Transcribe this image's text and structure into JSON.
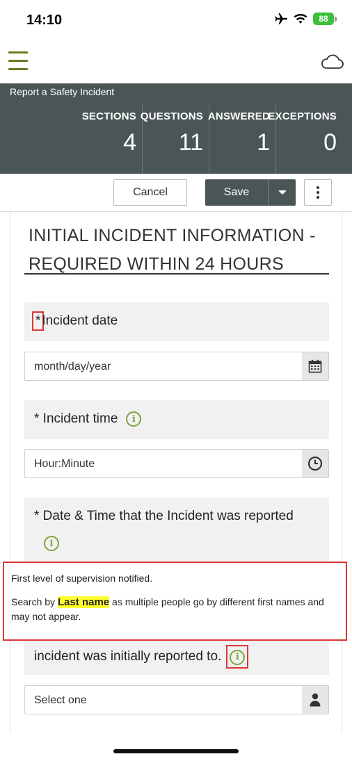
{
  "status_bar": {
    "time": "14:10",
    "battery": "88"
  },
  "header": {
    "title": "Report a Safety Incident",
    "stats": [
      {
        "label": "SECTIONS",
        "value": "4"
      },
      {
        "label": "QUESTIONS",
        "value": "11"
      },
      {
        "label": "ANSWERED",
        "value": "1"
      },
      {
        "label": "EXCEPTIONS",
        "value": "0"
      }
    ]
  },
  "toolbar": {
    "cancel_label": "Cancel",
    "save_label": "Save"
  },
  "section": {
    "title": "INITIAL INCIDENT INFORMATION - REQUIRED WITHIN 24 HOURS"
  },
  "questions": {
    "incident_date": {
      "star": "*",
      "label": "Incident date",
      "placeholder": "month/day/year"
    },
    "incident_time": {
      "label": "* Incident time",
      "placeholder": "Hour:Minute"
    },
    "reported_datetime": {
      "label": "* Date & Time that the Incident was reported"
    },
    "reported_to": {
      "label": "incident was initially reported to.",
      "placeholder": "Select one"
    }
  },
  "tooltip": {
    "line1": "First level of supervision notified.",
    "prefix": "Search by ",
    "highlight": "Last name",
    "suffix": " as multiple people go by different first names and may not appear."
  },
  "colors": {
    "header_bg": "#4a5656",
    "accent_green": "#7fa33a",
    "highlight_box": "#e03535",
    "menu_olive": "#6b7a1c"
  },
  "icons": [
    "menu-icon",
    "cloud-icon",
    "calendar-icon",
    "clock-icon",
    "info-icon",
    "person-icon",
    "airplane-icon",
    "wifi-icon",
    "battery-icon"
  ]
}
